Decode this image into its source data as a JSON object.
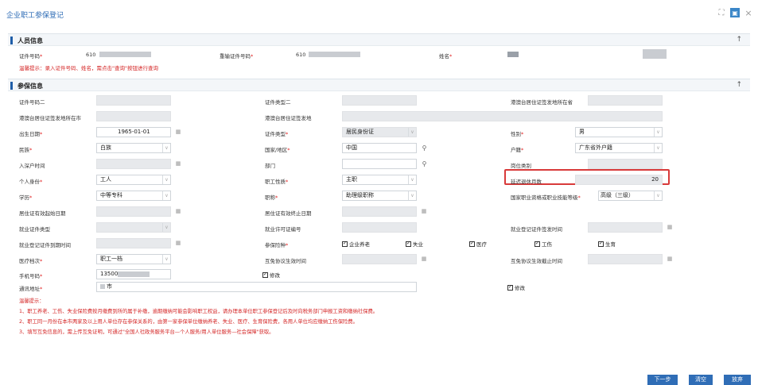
{
  "window": {
    "title": "企业职工参保登记"
  },
  "person": {
    "section_title": "人员信息",
    "id_label": "证件号码",
    "id_value_prefix": "610",
    "repeat_id_label": "重输证件号码",
    "repeat_id_value_prefix": "610",
    "name_label": "姓名",
    "hint": "温馨提示：录入证件号码、姓名，需点击\"查询\"按钮进行查询"
  },
  "insurance": {
    "section_title": "参保信息",
    "labels": {
      "id2": "证件号码二",
      "id_type2": "证件类型二",
      "hk_residence_place": "港澳台居住证签发地所在省",
      "hk_city": "港澳台居住证签发地所在市",
      "hk_place": "港澳台居住证签发地",
      "birth": "出生日期",
      "id_type": "证件类型",
      "gender": "性别",
      "ethnicity": "民族",
      "country": "国家/地区",
      "hukou": "户籍",
      "entry_time": "入深户时间",
      "dept": "部门",
      "post": "岗位类别",
      "identity": "个人身份",
      "job_nature": "职工性质",
      "delay_months": "延迟退休月数",
      "education": "学历",
      "title": "职称",
      "qualification": "国家职业资格或职业技能等级",
      "res_start": "居住证有效起始日期",
      "res_end": "居住证有效终止日期",
      "emp_type": "就业证件类型",
      "emp_permit": "就业许可证编号",
      "emp_issue": "就业登记证件签发时间",
      "emp_expire": "就业登记证件到期时间",
      "insurance_types": "参保险种",
      "medical_level": "医疗档次",
      "exempt_start": "互免协议生效时间",
      "exempt_end": "互免协议生效截止时间",
      "mobile": "手机号码",
      "address": "通讯地址"
    },
    "values": {
      "birth": "1965-01-01",
      "id_type": "居民身份证",
      "gender": "男",
      "ethnicity": "白族",
      "country": "中国",
      "hukou": "广东省外户籍",
      "identity": "工人",
      "job_nature": "主职",
      "delay_months": "20",
      "education": "中等专科",
      "title": "助理级职称",
      "qualification": "高级（三级）",
      "medical_level": "职工一档",
      "mobile": "13500",
      "address_suffix": "市"
    },
    "checks": {
      "pension": "企业养老",
      "unemployment": "失业",
      "medical": "医疗",
      "injury": "工伤",
      "maternity": "生育",
      "modify_mobile": "修改",
      "modify_address": "修改"
    }
  },
  "notes": {
    "title": "温馨提示：",
    "line1": "1、职工养老、工伤、失业保险费按月缴费到所的属于补缴，逾期缴纳可能会影响职工权益，请办理本单位职工参保登记后及时向税务部门申报工资和缴纳社保费。",
    "line2": "2、职工同一月份在本市两家及以上用人单位存在参保关系的，由第一家参保单位缴纳养老、失业、医疗、生育保险费，各用人单位均应缴纳工伤保险费。",
    "line3": "3、填写互免信息的，需上传互免证明，可通过\"全国人社政务服务平台—个人服务/用人单位服务—社会保障\"获取。"
  },
  "buttons": {
    "next": "下一步",
    "clear": "清空",
    "abandon": "放弃"
  },
  "colors": {
    "primary": "#2f6db6",
    "title": "#2c6bb5",
    "warning": "#d42424",
    "highlight": "#d83a3a"
  }
}
